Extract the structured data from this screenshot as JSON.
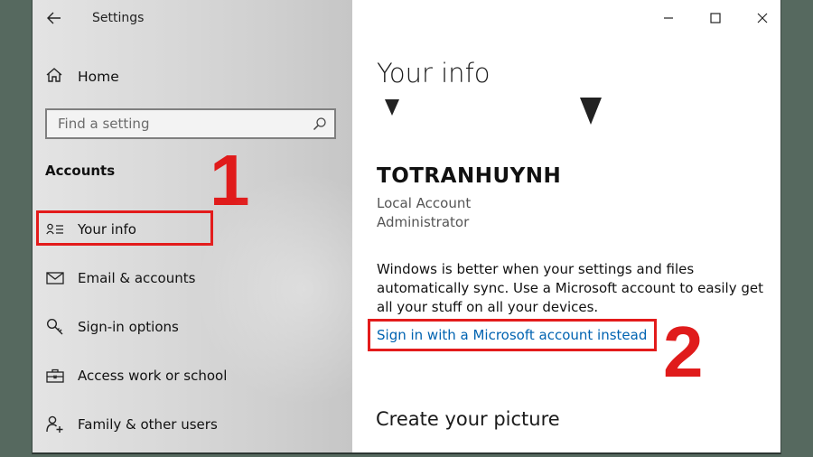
{
  "window": {
    "title": "Settings",
    "controls": [
      "minimize-icon",
      "maximize-icon",
      "close-icon"
    ]
  },
  "sidebar": {
    "home_label": "Home",
    "search_placeholder": "Find a setting",
    "section_title": "Accounts",
    "items": [
      {
        "label": "Your info",
        "icon": "contact-card-icon",
        "selected": true
      },
      {
        "label": "Email & accounts",
        "icon": "mail-icon"
      },
      {
        "label": "Sign-in options",
        "icon": "key-icon"
      },
      {
        "label": "Access work or school",
        "icon": "briefcase-icon"
      },
      {
        "label": "Family & other users",
        "icon": "person-add-icon"
      }
    ]
  },
  "annotations": {
    "step1": "1",
    "step2": "2",
    "color": "#e31b1b"
  },
  "main": {
    "heading": "Your info",
    "username": "TOTRANHUYNH",
    "account_type": "Local Account",
    "role": "Administrator",
    "sync_text": "Windows is better when your settings and files automatically sync. Use a Microsoft account to easily get all your stuff on all your devices.",
    "signin_link": "Sign in with a Microsoft account instead",
    "create_picture_heading": "Create your picture"
  },
  "colors": {
    "link": "#0063b1",
    "background": "#56695f"
  }
}
